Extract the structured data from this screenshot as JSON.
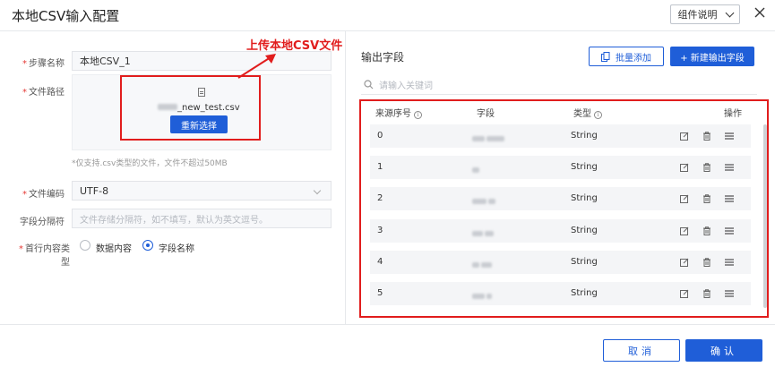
{
  "dialog": {
    "title": "本地CSV输入配置",
    "help_label": "组件说明"
  },
  "annotation": {
    "text": "上传本地CSV文件"
  },
  "form": {
    "step_name": {
      "label": "步骤名称",
      "value": "本地CSV_1"
    },
    "file_path": {
      "label": "文件路径",
      "file_name_suffix": "_new_test.csv",
      "reselect_label": "重新选择"
    },
    "hint": "*仅支持.csv类型的文件，文件不超过50MB",
    "encoding": {
      "label": "文件编码",
      "value": "UTF-8"
    },
    "separator": {
      "label": "字段分隔符",
      "placeholder": "文件存储分隔符，如不填写，默认为英文逗号。"
    },
    "first_row_type": {
      "label": "首行内容类型",
      "options": [
        "数据内容",
        "字段名称"
      ],
      "selected": "字段名称"
    }
  },
  "output": {
    "title": "输出字段",
    "batch_add_label": "批量添加",
    "new_field_label": "+ 新建输出字段",
    "search_placeholder": "请输入关键词",
    "columns": {
      "source_index": "来源序号",
      "field": "字段",
      "type": "类型",
      "actions": "操作"
    },
    "rows": [
      {
        "source_index": "0",
        "type": "String"
      },
      {
        "source_index": "1",
        "type": "String"
      },
      {
        "source_index": "2",
        "type": "String"
      },
      {
        "source_index": "3",
        "type": "String"
      },
      {
        "source_index": "4",
        "type": "String"
      },
      {
        "source_index": "5",
        "type": "String"
      }
    ]
  },
  "footer": {
    "cancel_label": "取消",
    "ok_label": "确认"
  },
  "colors": {
    "primary": "#1f5ed8",
    "annotation": "#e11d1d"
  }
}
